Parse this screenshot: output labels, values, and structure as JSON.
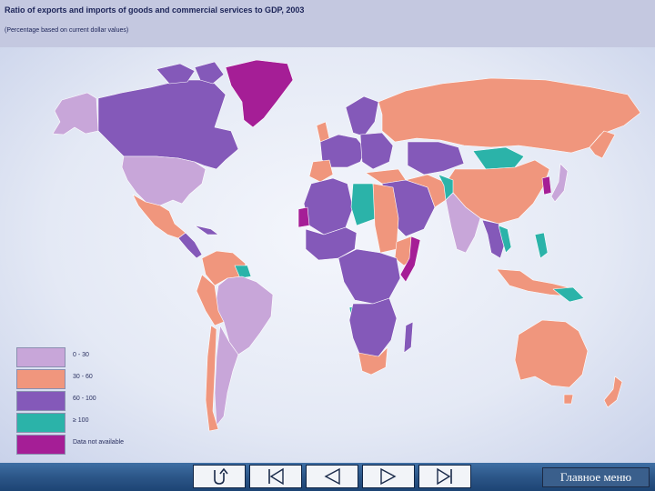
{
  "header": {
    "title": "Ratio of exports and imports of goods and commercial services to GDP, 2003",
    "subtitle": "(Percentage based on current dollar values)"
  },
  "legend": [
    {
      "label": "0 - 30",
      "color": "#c8a6d9"
    },
    {
      "label": "30 - 60",
      "color": "#f0967d"
    },
    {
      "label": "60 - 100",
      "color": "#8459b9"
    },
    {
      "label": "≥ 100",
      "color": "#2bb3a9"
    },
    {
      "label": "Data not available",
      "color": "#a51e96"
    }
  ],
  "map": {
    "ocean_color": "#e6ebf6",
    "regions": [
      {
        "name": "Alaska",
        "category": "0 - 30"
      },
      {
        "name": "Canada",
        "category": "60 - 100"
      },
      {
        "name": "Greenland",
        "category": "Data not available"
      },
      {
        "name": "United States",
        "category": "0 - 30"
      },
      {
        "name": "Mexico",
        "category": "30 - 60"
      },
      {
        "name": "Brazil",
        "category": "0 - 30"
      },
      {
        "name": "Russia",
        "category": "30 - 60"
      },
      {
        "name": "China",
        "category": "30 - 60"
      },
      {
        "name": "India",
        "category": "0 - 30"
      },
      {
        "name": "Australia",
        "category": "30 - 60"
      },
      {
        "name": "Somalia",
        "category": "Data not available"
      },
      {
        "name": "Mongolia",
        "category": "≥ 100"
      }
    ]
  },
  "nav": {
    "buttons": [
      {
        "name": "return-button",
        "icon": "return-arrow-icon"
      },
      {
        "name": "first-button",
        "icon": "first-slide-icon"
      },
      {
        "name": "prev-button",
        "icon": "prev-triangle-icon"
      },
      {
        "name": "next-button",
        "icon": "next-triangle-icon"
      },
      {
        "name": "last-button",
        "icon": "last-slide-icon"
      }
    ],
    "menu_label": "Главное меню"
  }
}
